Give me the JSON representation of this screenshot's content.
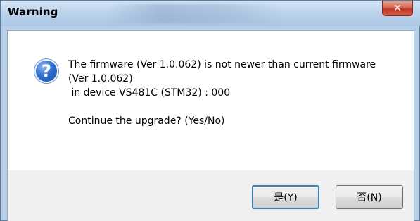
{
  "window": {
    "title": "Warning",
    "close_glyph": "✕"
  },
  "icon": {
    "name": "question-icon",
    "glyph": "?"
  },
  "message": {
    "line1": "The firmware (Ver 1.0.062) is not newer than current firmware",
    "line2": "(Ver 1.0.062)",
    "line3": " in device VS481C (STM32) : 000",
    "line4": "Continue the upgrade? (Yes/No)"
  },
  "buttons": {
    "yes_label": "是(Y)",
    "no_label": "否(N)"
  }
}
